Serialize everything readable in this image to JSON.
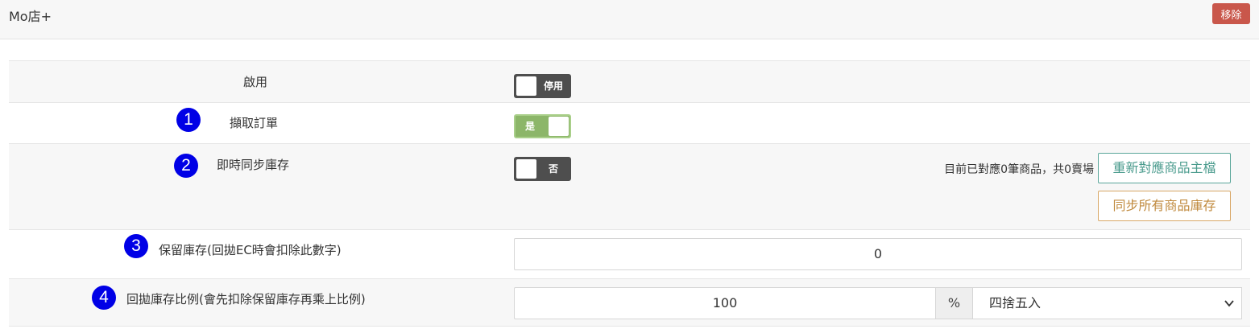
{
  "header": {
    "title": "Mo店+",
    "remove_label": "移除"
  },
  "rows": {
    "enable": {
      "label": "啟用",
      "toggle_text": "停用",
      "toggle_on": false
    },
    "fetch_orders": {
      "number": "1",
      "label": "擷取訂單",
      "toggle_text": "是",
      "toggle_on": true
    },
    "realtime_sync": {
      "number": "2",
      "label": "即時同步庫存",
      "toggle_text": "否",
      "toggle_on": false,
      "status_text": "目前已對應0筆商品，共0賣場",
      "remap_label": "重新對應商品主檔",
      "sync_all_label": "同步所有商品庫存"
    },
    "reserve_stock": {
      "number": "3",
      "label": "保留庫存(回拋EC時會扣除此數字)",
      "value": "0"
    },
    "return_ratio": {
      "number": "4",
      "label": "回拋庫存比例(會先扣除保留庫存再乘上比例)",
      "value": "100",
      "unit": "%",
      "rounding_selected": "四捨五入"
    }
  },
  "colors": {
    "remove": "#c9574b",
    "toggle_off": "#4e4e4e",
    "toggle_on": "#8cb669",
    "number_badge": "#0000e6",
    "teal": "#4a9b8d",
    "amber": "#c08a3e"
  }
}
